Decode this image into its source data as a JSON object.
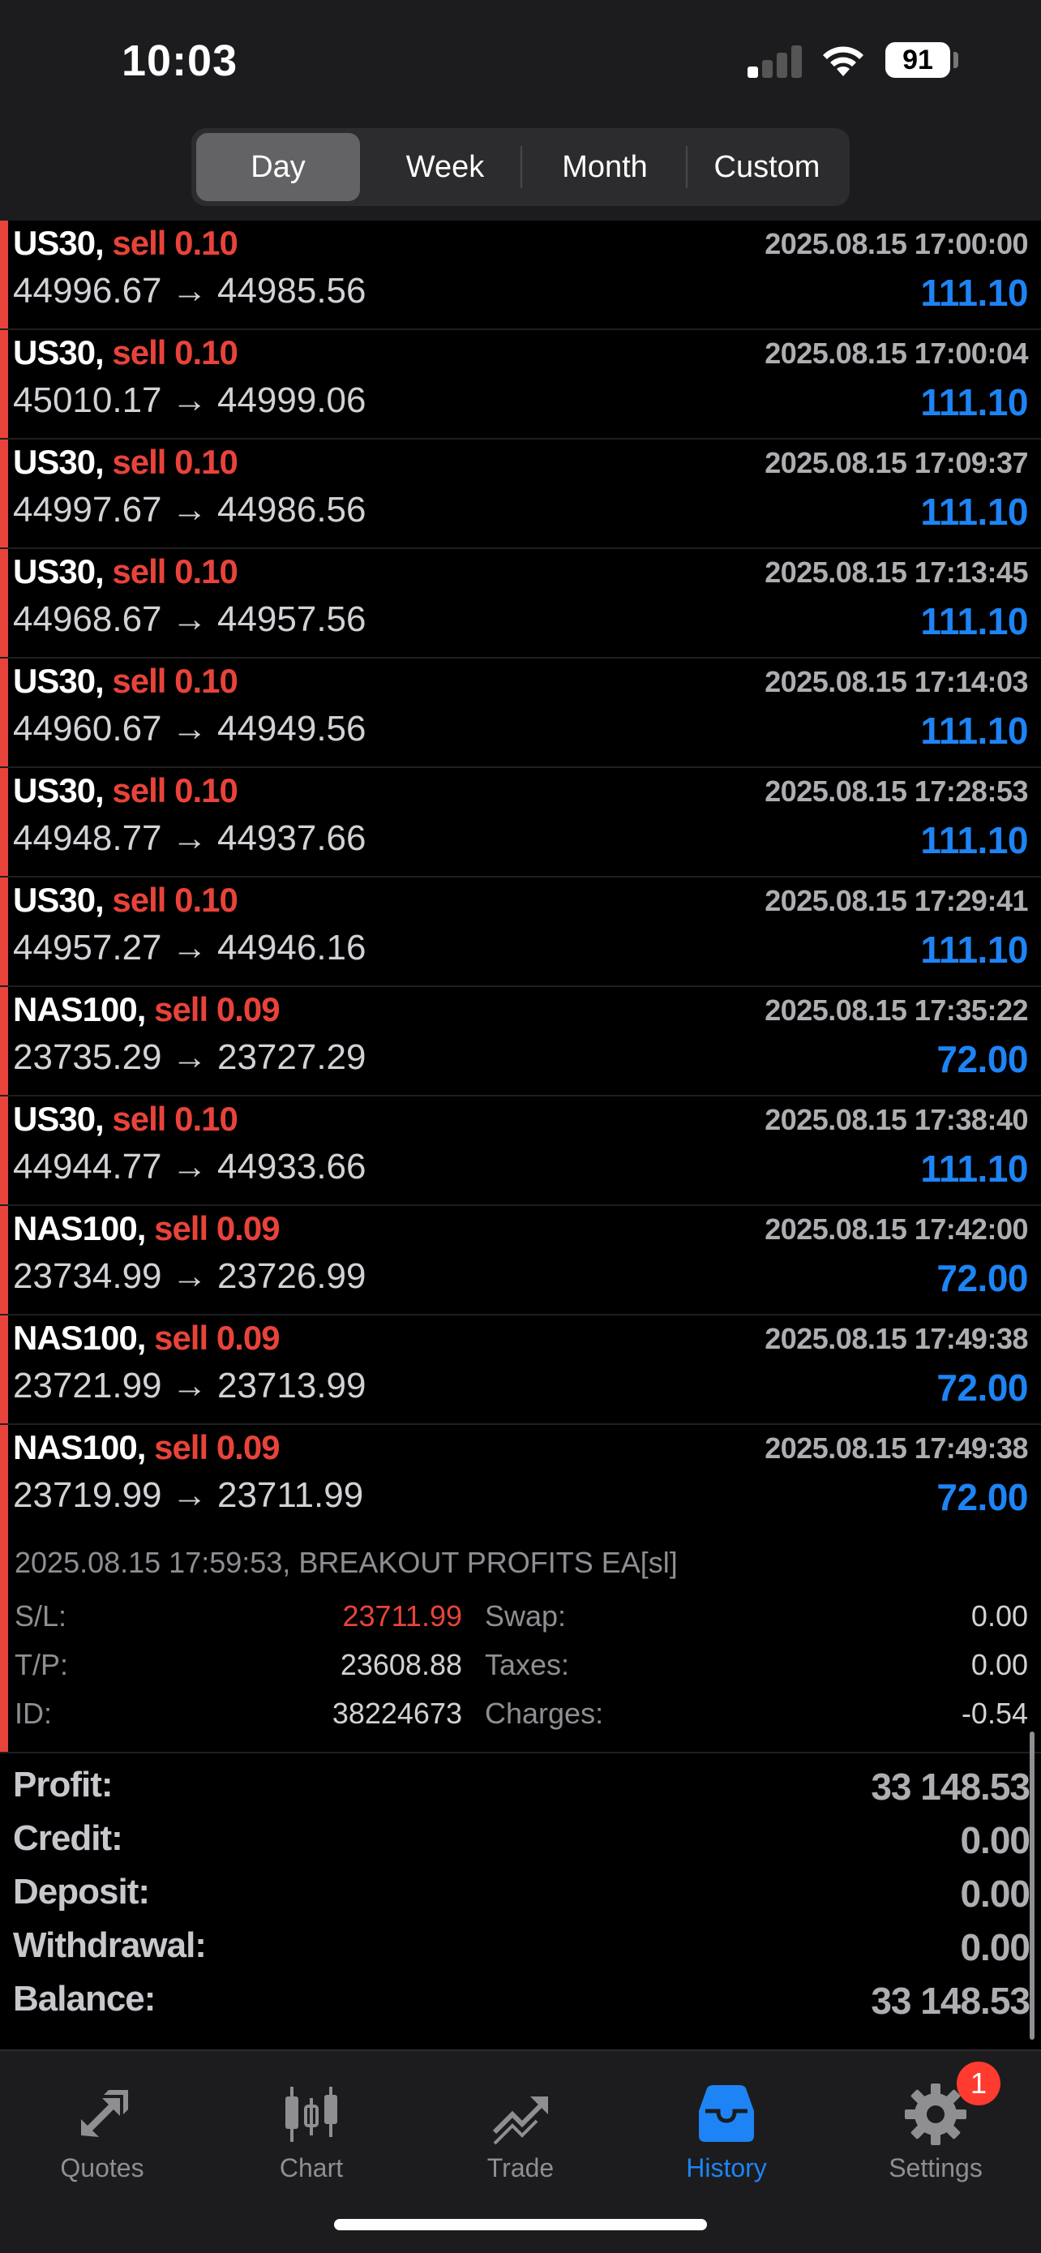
{
  "status": {
    "time": "10:03",
    "battery": "91"
  },
  "periods": [
    "Day",
    "Week",
    "Month",
    "Custom"
  ],
  "active_period": "Day",
  "deals": [
    {
      "symbol": "US30,",
      "type": "sell 0.10",
      "prices": "44996.67 → 44985.56",
      "time": "2025.08.15 17:00:00",
      "profit": "111.10"
    },
    {
      "symbol": "US30,",
      "type": "sell 0.10",
      "prices": "45010.17 → 44999.06",
      "time": "2025.08.15 17:00:04",
      "profit": "111.10"
    },
    {
      "symbol": "US30,",
      "type": "sell 0.10",
      "prices": "44997.67 → 44986.56",
      "time": "2025.08.15 17:09:37",
      "profit": "111.10"
    },
    {
      "symbol": "US30,",
      "type": "sell 0.10",
      "prices": "44968.67 → 44957.56",
      "time": "2025.08.15 17:13:45",
      "profit": "111.10"
    },
    {
      "symbol": "US30,",
      "type": "sell 0.10",
      "prices": "44960.67 → 44949.56",
      "time": "2025.08.15 17:14:03",
      "profit": "111.10"
    },
    {
      "symbol": "US30,",
      "type": "sell 0.10",
      "prices": "44948.77 → 44937.66",
      "time": "2025.08.15 17:28:53",
      "profit": "111.10"
    },
    {
      "symbol": "US30,",
      "type": "sell 0.10",
      "prices": "44957.27 → 44946.16",
      "time": "2025.08.15 17:29:41",
      "profit": "111.10"
    },
    {
      "symbol": "NAS100,",
      "type": "sell 0.09",
      "prices": "23735.29 → 23727.29",
      "time": "2025.08.15 17:35:22",
      "profit": "72.00"
    },
    {
      "symbol": "US30,",
      "type": "sell 0.10",
      "prices": "44944.77 → 44933.66",
      "time": "2025.08.15 17:38:40",
      "profit": "111.10"
    },
    {
      "symbol": "NAS100,",
      "type": "sell 0.09",
      "prices": "23734.99 → 23726.99",
      "time": "2025.08.15 17:42:00",
      "profit": "72.00"
    },
    {
      "symbol": "NAS100,",
      "type": "sell 0.09",
      "prices": "23721.99 → 23713.99",
      "time": "2025.08.15 17:49:38",
      "profit": "72.00"
    },
    {
      "symbol": "NAS100,",
      "type": "sell 0.09",
      "prices": "23719.99 → 23711.99",
      "time": "2025.08.15 17:49:38",
      "profit": "72.00"
    }
  ],
  "detail": {
    "comment": "2025.08.15 17:59:53, BREAKOUT PROFITS EA[sl]",
    "sl_label": "S/L:",
    "sl_value": "23711.99",
    "tp_label": "T/P:",
    "tp_value": "23608.88",
    "id_label": "ID:",
    "id_value": "38224673",
    "swap_label": "Swap:",
    "swap_value": "0.00",
    "taxes_label": "Taxes:",
    "taxes_value": "0.00",
    "charges_label": "Charges:",
    "charges_value": "-0.54"
  },
  "summary": {
    "profit_label": "Profit:",
    "profit_value": "33 148.53",
    "credit_label": "Credit:",
    "credit_value": "0.00",
    "deposit_label": "Deposit:",
    "deposit_value": "0.00",
    "withdrawal_label": "Withdrawal:",
    "withdrawal_value": "0.00",
    "balance_label": "Balance:",
    "balance_value": "33 148.53"
  },
  "tabs": [
    {
      "label": "Quotes",
      "icon": "quotes-arrows-icon"
    },
    {
      "label": "Chart",
      "icon": "candlestick-icon"
    },
    {
      "label": "Trade",
      "icon": "trend-line-icon"
    },
    {
      "label": "History",
      "icon": "inbox-tray-icon"
    },
    {
      "label": "Settings",
      "icon": "gear-icon"
    }
  ],
  "active_tab": "History",
  "settings_badge": "1",
  "colors": {
    "sell": "#e8433a",
    "profit": "#1e84f5",
    "active_tab": "#1e84f5"
  }
}
